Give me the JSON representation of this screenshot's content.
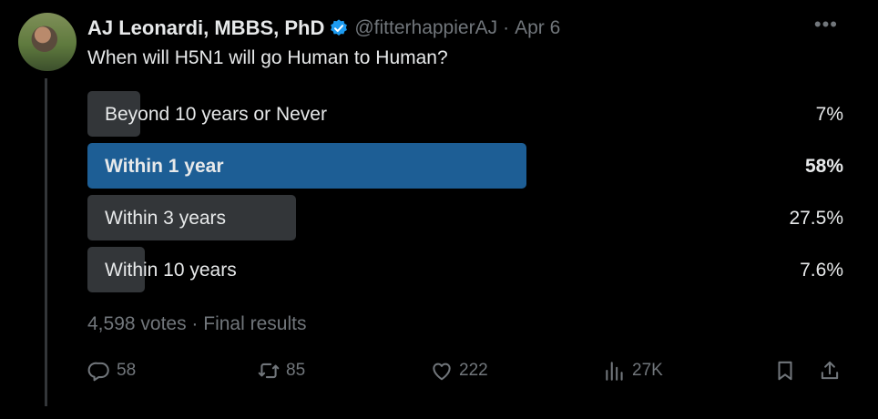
{
  "author": {
    "name": "AJ Leonardi, MBBS, PhD",
    "handle": "@fitterhappierAJ",
    "separator": "·",
    "date": "Apr 6"
  },
  "more_label": "•••",
  "question": "When will H5N1 will go Human to Human?",
  "poll": {
    "options": [
      {
        "label": "Beyond 10 years or Never",
        "percent": "7%"
      },
      {
        "label": "Within 1 year",
        "percent": "58%"
      },
      {
        "label": "Within 3 years",
        "percent": "27.5%"
      },
      {
        "label": "Within 10 years",
        "percent": "7.6%"
      }
    ],
    "results_text": "4,598 votes · Final results"
  },
  "actions": {
    "replies": "58",
    "reposts": "85",
    "likes": "222",
    "views": "27K"
  },
  "colors": {
    "background": "#000000",
    "text": "#e7e9ea",
    "muted": "#71767b",
    "bar": "#333639",
    "winner_bar": "#1d5e95",
    "verified": "#1d9bf0"
  }
}
